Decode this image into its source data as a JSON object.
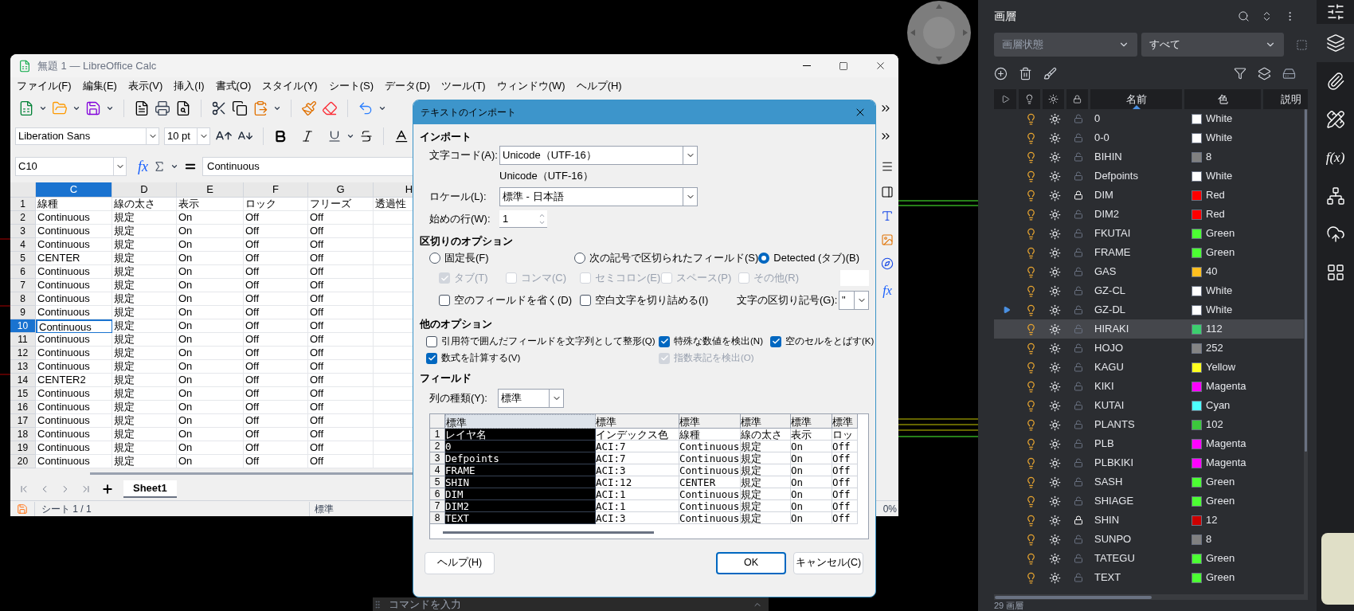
{
  "calc": {
    "title": "無題 1 — LibreOffice Calc",
    "menu": [
      "ファイル(F)",
      "編集(E)",
      "表示(V)",
      "挿入(I)",
      "書式(O)",
      "スタイル(Y)",
      "シート(S)",
      "データ(D)",
      "ツール(T)",
      "ウィンドウ(W)",
      "ヘルプ(H)"
    ],
    "font_name": "Liberation Sans",
    "font_size": "10 pt",
    "name_box": "C10",
    "function_glyph": "fx",
    "formula": "Continuous",
    "columns": [
      {
        "label": "C",
        "selected": true
      },
      {
        "label": "D",
        "selected": false
      },
      {
        "label": "E",
        "selected": false
      },
      {
        "label": "F",
        "selected": false
      },
      {
        "label": "G",
        "selected": false
      },
      {
        "label": "H",
        "selected": false
      }
    ],
    "rows": [
      {
        "label": "1",
        "selected": false,
        "cells": [
          "線種",
          "線の太さ",
          "表示",
          "ロック",
          "フリーズ",
          "透過性"
        ]
      },
      {
        "label": "2",
        "selected": false,
        "cells": [
          "Continuous",
          "規定",
          "On",
          "Off",
          "Off"
        ]
      },
      {
        "label": "3",
        "selected": false,
        "cells": [
          "Continuous",
          "規定",
          "On",
          "Off",
          "Off"
        ]
      },
      {
        "label": "4",
        "selected": false,
        "cells": [
          "Continuous",
          "規定",
          "On",
          "Off",
          "Off"
        ]
      },
      {
        "label": "5",
        "selected": false,
        "cells": [
          "CENTER",
          "規定",
          "On",
          "Off",
          "Off"
        ]
      },
      {
        "label": "6",
        "selected": false,
        "cells": [
          "Continuous",
          "規定",
          "On",
          "Off",
          "Off"
        ]
      },
      {
        "label": "7",
        "selected": false,
        "cells": [
          "Continuous",
          "規定",
          "On",
          "Off",
          "Off"
        ]
      },
      {
        "label": "8",
        "selected": false,
        "cells": [
          "Continuous",
          "規定",
          "On",
          "Off",
          "Off"
        ]
      },
      {
        "label": "9",
        "selected": false,
        "cells": [
          "Continuous",
          "規定",
          "On",
          "Off",
          "Off"
        ]
      },
      {
        "label": "10",
        "selected": true,
        "cells": [
          "Continuous",
          "規定",
          "On",
          "Off",
          "Off"
        ]
      },
      {
        "label": "11",
        "selected": false,
        "cells": [
          "Continuous",
          "規定",
          "On",
          "Off",
          "Off"
        ]
      },
      {
        "label": "12",
        "selected": false,
        "cells": [
          "Continuous",
          "規定",
          "On",
          "Off",
          "Off"
        ]
      },
      {
        "label": "13",
        "selected": false,
        "cells": [
          "Continuous",
          "規定",
          "On",
          "Off",
          "Off"
        ]
      },
      {
        "label": "14",
        "selected": false,
        "cells": [
          "CENTER2",
          "規定",
          "On",
          "Off",
          "Off"
        ]
      },
      {
        "label": "15",
        "selected": false,
        "cells": [
          "Continuous",
          "規定",
          "On",
          "Off",
          "Off"
        ]
      },
      {
        "label": "16",
        "selected": false,
        "cells": [
          "Continuous",
          "規定",
          "On",
          "Off",
          "Off"
        ]
      },
      {
        "label": "17",
        "selected": false,
        "cells": [
          "Continuous",
          "規定",
          "On",
          "Off",
          "Off"
        ]
      },
      {
        "label": "18",
        "selected": false,
        "cells": [
          "Continuous",
          "規定",
          "On",
          "Off",
          "Off"
        ]
      },
      {
        "label": "19",
        "selected": false,
        "cells": [
          "Continuous",
          "規定",
          "On",
          "Off",
          "Off"
        ]
      },
      {
        "label": "20",
        "selected": false,
        "cells": [
          "Continuous",
          "規定",
          "On",
          "Off",
          "Off"
        ]
      }
    ],
    "sheet_tabs": [
      {
        "label": "Sheet1",
        "selected": true
      }
    ],
    "sidebar_glyph": "fx",
    "status": {
      "sheet": "シート 1 / 1",
      "style": "標準",
      "zoom": "0%"
    }
  },
  "dialog": {
    "title": "テキストのインポート",
    "import": {
      "heading": "インポート",
      "charset_label": "文字コード(A):",
      "charset": "Unicode（UTF-16）",
      "charset_note": "Unicode（UTF-16）",
      "locale_label": "ロケール(L):",
      "locale": "標準 - 日本語",
      "start_row_label": "始めの行(W):",
      "start_row": "1"
    },
    "separator": {
      "heading": "区切りのオプション",
      "modes": [
        {
          "label": "固定長(F)",
          "selected": false
        },
        {
          "label": "次の記号で区切られたフィールド(S)",
          "selected": false
        },
        {
          "label": "Detected (タブ)(B)",
          "selected": true
        }
      ],
      "separators": [
        {
          "label": "タブ(T)",
          "checked": true,
          "disabled": true
        },
        {
          "label": "コンマ(C)",
          "checked": false,
          "disabled": true
        },
        {
          "label": "セミコロン(E)",
          "checked": false,
          "disabled": true
        },
        {
          "label": "スペース(P)",
          "checked": false,
          "disabled": true
        },
        {
          "label": "その他(R)",
          "checked": false,
          "disabled": true
        }
      ],
      "options": [
        {
          "label": "空のフィールドを省く(D)",
          "checked": false,
          "disabled": false
        },
        {
          "label": "空白文字を切り詰める(I)",
          "checked": false,
          "disabled": false
        }
      ],
      "string_delimiter_label": "文字の区切り記号(G):",
      "string_delimiter": "\""
    },
    "other": {
      "heading": "他のオプション",
      "options": [
        {
          "label": "引用符で囲んだフィールドを文字列として整形(Q)",
          "checked": false,
          "disabled": false
        },
        {
          "label": "特殊な数値を検出(N)",
          "checked": true,
          "disabled": false
        },
        {
          "label": "空のセルをとばす(K)",
          "checked": true,
          "disabled": false
        },
        {
          "label": "数式を計算する(V)",
          "checked": true,
          "disabled": false
        },
        {
          "label": "指数表記を検出(O)",
          "checked": true,
          "disabled": true
        }
      ]
    },
    "fields": {
      "heading": "フィールド",
      "column_type_label": "列の種類(Y):",
      "column_type": "標準",
      "columns": [
        {
          "label": "標準",
          "selected": true
        },
        {
          "label": "標準",
          "selected": false
        },
        {
          "label": "標準",
          "selected": false
        },
        {
          "label": "標準",
          "selected": false
        },
        {
          "label": "標準",
          "selected": false
        },
        {
          "label": "標準",
          "selected": false
        }
      ],
      "rows": [
        {
          "label": "1",
          "cells": [
            "レイヤ名",
            "インデックス色",
            "線種",
            "線の太さ",
            "表示",
            "ロッ"
          ]
        },
        {
          "label": "2",
          "cells": [
            "0",
            "ACI:7",
            "Continuous",
            "規定",
            "On",
            "Off"
          ]
        },
        {
          "label": "3",
          "cells": [
            "Defpoints",
            "ACI:7",
            "Continuous",
            "規定",
            "On",
            "Off"
          ]
        },
        {
          "label": "4",
          "cells": [
            "FRAME",
            "ACI:3",
            "Continuous",
            "規定",
            "On",
            "Off"
          ]
        },
        {
          "label": "5",
          "cells": [
            "SHIN",
            "ACI:12",
            "CENTER",
            "規定",
            "On",
            "Off"
          ]
        },
        {
          "label": "6",
          "cells": [
            "DIM",
            "ACI:1",
            "Continuous",
            "規定",
            "On",
            "Off"
          ]
        },
        {
          "label": "7",
          "cells": [
            "DIM2",
            "ACI:1",
            "Continuous",
            "規定",
            "On",
            "Off"
          ]
        },
        {
          "label": "8",
          "cells": [
            "TEXT",
            "ACI:3",
            "Continuous",
            "規定",
            "On",
            "Off"
          ]
        }
      ]
    },
    "buttons": [
      {
        "label": "ヘルプ(H)",
        "default": false
      },
      {
        "label": "OK",
        "default": true
      },
      {
        "label": "キャンセル(C)",
        "default": false
      }
    ]
  },
  "command_line": {
    "placeholder": "コマンドを入力"
  },
  "layers": {
    "title": "画層",
    "state_placeholder": "画層状態",
    "filter": "すべて",
    "columns": [
      "名前",
      "色",
      "説明"
    ],
    "items": [
      {
        "name": "0",
        "color_name": "White",
        "color": "#ffffff",
        "on": true,
        "frozen": false,
        "locked": false,
        "current": false,
        "selected": false
      },
      {
        "name": "0-0",
        "color_name": "White",
        "color": "#ffffff",
        "on": true,
        "frozen": false,
        "locked": false,
        "current": false,
        "selected": false
      },
      {
        "name": "BIHIN",
        "color_name": "8",
        "color": "#808080",
        "on": true,
        "frozen": false,
        "locked": false,
        "current": false,
        "selected": false
      },
      {
        "name": "Defpoints",
        "color_name": "White",
        "color": "#ffffff",
        "on": true,
        "frozen": false,
        "locked": false,
        "current": false,
        "selected": false
      },
      {
        "name": "DIM",
        "color_name": "Red",
        "color": "#ff0000",
        "on": true,
        "frozen": false,
        "locked": true,
        "current": false,
        "selected": false
      },
      {
        "name": "DIM2",
        "color_name": "Red",
        "color": "#ff0000",
        "on": true,
        "frozen": false,
        "locked": false,
        "current": false,
        "selected": false
      },
      {
        "name": "FKUTAI",
        "color_name": "Green",
        "color": "#4cff33",
        "on": true,
        "frozen": false,
        "locked": false,
        "current": false,
        "selected": false
      },
      {
        "name": "FRAME",
        "color_name": "Green",
        "color": "#4cff33",
        "on": true,
        "frozen": false,
        "locked": false,
        "current": false,
        "selected": false
      },
      {
        "name": "GAS",
        "color_name": "40",
        "color": "#ffbf1f",
        "on": true,
        "frozen": false,
        "locked": false,
        "current": false,
        "selected": false
      },
      {
        "name": "GZ-CL",
        "color_name": "White",
        "color": "#ffffff",
        "on": true,
        "frozen": false,
        "locked": false,
        "current": false,
        "selected": false
      },
      {
        "name": "GZ-DL",
        "color_name": "White",
        "color": "#ffffff",
        "on": true,
        "frozen": false,
        "locked": false,
        "current": true,
        "selected": false
      },
      {
        "name": "HIRAKI",
        "color_name": "112",
        "color": "#3ccf6e",
        "on": true,
        "frozen": false,
        "locked": false,
        "current": false,
        "selected": true
      },
      {
        "name": "HOJO",
        "color_name": "252",
        "color": "#848484",
        "on": true,
        "frozen": false,
        "locked": false,
        "current": false,
        "selected": false
      },
      {
        "name": "KAGU",
        "color_name": "Yellow",
        "color": "#ffff1f",
        "on": true,
        "frozen": false,
        "locked": false,
        "current": false,
        "selected": false
      },
      {
        "name": "KIKI",
        "color_name": "Magenta",
        "color": "#ff00ff",
        "on": true,
        "frozen": false,
        "locked": false,
        "current": false,
        "selected": false
      },
      {
        "name": "KUTAI",
        "color_name": "Cyan",
        "color": "#4dffff",
        "on": true,
        "frozen": false,
        "locked": false,
        "current": false,
        "selected": false
      },
      {
        "name": "PLANTS",
        "color_name": "102",
        "color": "#3cc83c",
        "on": true,
        "frozen": false,
        "locked": false,
        "current": false,
        "selected": false
      },
      {
        "name": "PLB",
        "color_name": "Magenta",
        "color": "#ff00ff",
        "on": true,
        "frozen": false,
        "locked": false,
        "current": false,
        "selected": false
      },
      {
        "name": "PLBKIKI",
        "color_name": "Magenta",
        "color": "#ff00ff",
        "on": true,
        "frozen": false,
        "locked": false,
        "current": false,
        "selected": false
      },
      {
        "name": "SASH",
        "color_name": "Green",
        "color": "#4cff33",
        "on": true,
        "frozen": false,
        "locked": false,
        "current": false,
        "selected": false
      },
      {
        "name": "SHIAGE",
        "color_name": "Green",
        "color": "#4cff33",
        "on": true,
        "frozen": false,
        "locked": false,
        "current": false,
        "selected": false
      },
      {
        "name": "SHIN",
        "color_name": "12",
        "color": "#cc0000",
        "on": true,
        "frozen": false,
        "locked": true,
        "current": false,
        "selected": false
      },
      {
        "name": "SUNPO",
        "color_name": "8",
        "color": "#808080",
        "on": true,
        "frozen": false,
        "locked": false,
        "current": false,
        "selected": false
      },
      {
        "name": "TATEGU",
        "color_name": "Green",
        "color": "#4cff33",
        "on": true,
        "frozen": false,
        "locked": false,
        "current": false,
        "selected": false
      },
      {
        "name": "TEXT",
        "color_name": "Green",
        "color": "#4cff33",
        "on": true,
        "frozen": false,
        "locked": false,
        "current": false,
        "selected": false
      }
    ],
    "count": "29 画層"
  },
  "side_strip": [
    {
      "kind": "sliders",
      "selected": false
    },
    {
      "kind": "layers",
      "selected": true
    },
    {
      "kind": "paperclip",
      "selected": false
    },
    {
      "kind": "drafting",
      "selected": false
    },
    {
      "kind": "function",
      "label": "f(x)",
      "selected": false
    },
    {
      "kind": "tree",
      "selected": false
    },
    {
      "kind": "cloud",
      "selected": false
    },
    {
      "kind": "grid",
      "selected": false
    }
  ]
}
